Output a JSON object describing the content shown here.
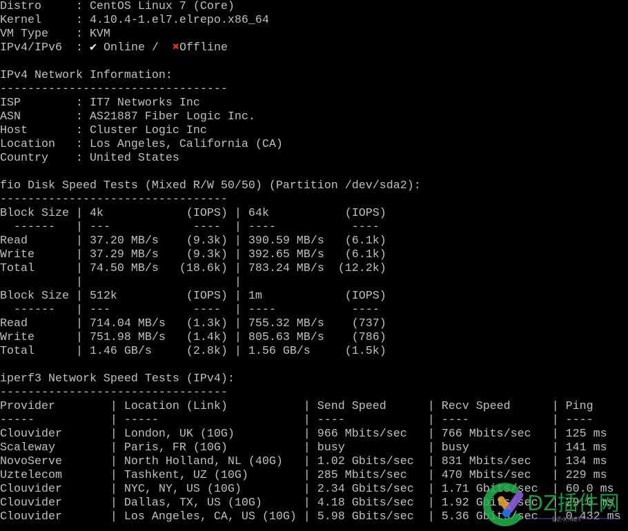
{
  "system": [
    {
      "label": "Distro",
      "value": "CentOS Linux 7 (Core)"
    },
    {
      "label": "Kernel",
      "value": "4.10.4-1.el7.elrepo.x86_64"
    },
    {
      "label": "VM Type",
      "value": "KVM"
    }
  ],
  "ipv": {
    "label": "IPv4/IPv6",
    "online_icon": "check-icon",
    "online": "Online",
    "sep": " / ",
    "offline_icon": "x-icon",
    "offline": "Offline",
    "check_glyph": "✔",
    "x_glyph": "✖",
    "colors": {
      "offline": "#e0301e"
    }
  },
  "network": {
    "title": "IPv4 Network Information:",
    "dashes": "---------------------------------",
    "rows": [
      {
        "label": "ISP",
        "value": "IT7 Networks Inc"
      },
      {
        "label": "ASN",
        "value": "AS21887 Fiber Logic Inc."
      },
      {
        "label": "Host",
        "value": "Cluster Logic Inc"
      },
      {
        "label": "Location",
        "value": "Los Angeles, California (CA)"
      },
      {
        "label": "Country",
        "value": "United States"
      }
    ]
  },
  "fio": {
    "title": "fio Disk Speed Tests (Mixed R/W 50/50) (Partition /dev/sda2):",
    "dashes": "---------------------------------",
    "blocks": [
      {
        "header": [
          "Block Size",
          "4k",
          "(IOPS)",
          "64k",
          "(IOPS)"
        ],
        "rows": [
          [
            "Read",
            "37.20 MB/s",
            "(9.3k)",
            "390.59 MB/s",
            "(6.1k)"
          ],
          [
            "Write",
            "37.29 MB/s",
            "(9.3k)",
            "392.65 MB/s",
            "(6.1k)"
          ],
          [
            "Total",
            "74.50 MB/s",
            "(18.6k)",
            "783.24 MB/s",
            "(12.2k)"
          ]
        ]
      },
      {
        "header": [
          "Block Size",
          "512k",
          "(IOPS)",
          "1m",
          "(IOPS)"
        ],
        "rows": [
          [
            "Read",
            "714.04 MB/s",
            "(1.3k)",
            "755.32 MB/s",
            "(737)"
          ],
          [
            "Write",
            "751.98 MB/s",
            "(1.4k)",
            "805.63 MB/s",
            "(786)"
          ],
          [
            "Total",
            "1.46 GB/s",
            "(2.8k)",
            "1.56 GB/s",
            "(1.5k)"
          ]
        ]
      }
    ],
    "sep": [
      "------",
      "---",
      "----",
      "----",
      "----"
    ]
  },
  "iperf": {
    "title": "iperf3 Network Speed Tests (IPv4):",
    "dashes": "---------------------------------",
    "headers": [
      "Provider",
      "Location (Link)",
      "Send Speed",
      "Recv Speed",
      "Ping"
    ],
    "sep": [
      "-----",
      "-----",
      "----",
      "----",
      "----"
    ],
    "rows": [
      [
        "Clouvider",
        "London, UK (10G)",
        "966 Mbits/sec",
        "766 Mbits/sec",
        "125 ms"
      ],
      [
        "Scaleway",
        "Paris, FR (10G)",
        "busy",
        "busy",
        "141 ms"
      ],
      [
        "NovoServe",
        "North Holland, NL (40G)",
        "1.02 Gbits/sec",
        "831 Mbits/sec",
        "134 ms"
      ],
      [
        "Uztelecom",
        "Tashkent, UZ (10G)",
        "285 Mbits/sec",
        "470 Mbits/sec",
        "229 ms"
      ],
      [
        "Clouvider",
        "NYC, NY, US (10G)",
        "2.34 Gbits/sec",
        "1.71 Gbits/sec",
        "60.0 ms"
      ],
      [
        "Clouvider",
        "Dallas, TX, US (10G)",
        "4.18 Gbits/sec",
        "1.92 Gbits/sec",
        "29.0 ms"
      ],
      [
        "Clouvider",
        "Los Angeles, CA, US (10G)",
        "5.98 Gbits/sec",
        "5.36 Gbits/sec",
        "0.432 ms"
      ]
    ]
  },
  "watermark": {
    "text": "DZ插件网",
    "sub": "DZ-X.NET",
    "color": "#22b14c"
  }
}
